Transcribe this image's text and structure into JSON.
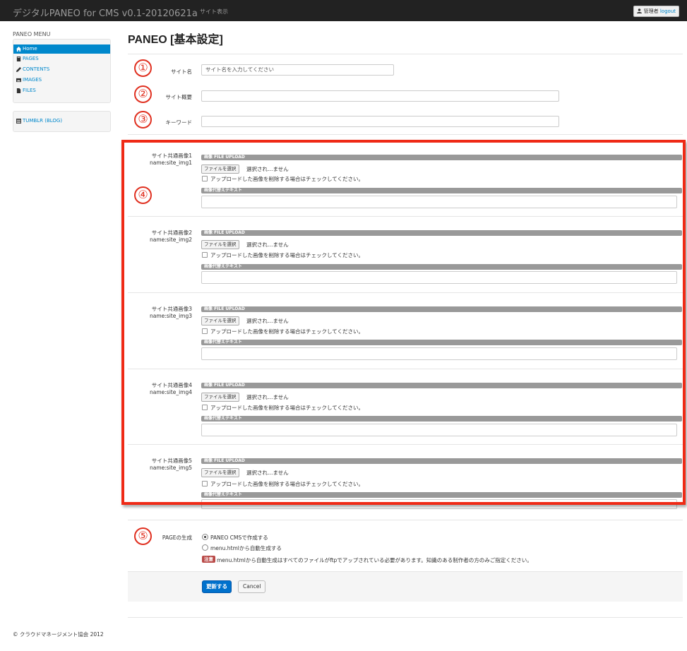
{
  "header": {
    "brand": "デジタルPANEO for CMS v0.1-20120621a",
    "nav_link": "サイト表示",
    "user_label": "管理者",
    "logout": "logout"
  },
  "sidebar": {
    "title": "PANEO MENU",
    "items": [
      {
        "label": "Home",
        "icon": "home-icon"
      },
      {
        "label": "PAGES",
        "icon": "book-icon"
      },
      {
        "label": "CONTENTS",
        "icon": "pencil-icon"
      },
      {
        "label": "IMAGES",
        "icon": "picture-icon"
      },
      {
        "label": "FILES",
        "icon": "file-icon"
      }
    ],
    "extra": {
      "label": "TUMBLR (BLOG)",
      "icon": "list-icon"
    }
  },
  "page": {
    "title": "PANEO [基本設定]"
  },
  "annotations": [
    "①",
    "②",
    "③",
    "④",
    "⑤"
  ],
  "fields": {
    "site_name": {
      "label": "サイト名",
      "value": "サイト名を入力してください"
    },
    "site_summary": {
      "label": "サイト概要",
      "value": ""
    },
    "keywords": {
      "label": "キーワード",
      "value": ""
    }
  },
  "images": [
    {
      "label": "サイト共通画像1",
      "name": "name:site_img1"
    },
    {
      "label": "サイト共通画像2",
      "name": "name:site_img2"
    },
    {
      "label": "サイト共通画像3",
      "name": "name:site_img3"
    },
    {
      "label": "サイト共通画像4",
      "name": "name:site_img4"
    },
    {
      "label": "サイト共通画像5",
      "name": "name:site_img5"
    }
  ],
  "image_ui": {
    "upload_bar": "画像 FILE UPLOAD",
    "file_button": "ファイルを選択",
    "file_status": "選択され…ません",
    "delete_check": "アップロードした画像を削除する場合はチェックしてください。",
    "alt_bar": "画像代替えテキスト"
  },
  "page_gen": {
    "label": "PAGEの生成",
    "options": [
      "PANEO CMSで作成する",
      "menu.htmlから自動生成する"
    ],
    "selected": 0,
    "note_badge": "注意",
    "note": "menu.htmlから自動生成はすべてのファイルがftpでアップされている必要があります。知識のある制作者の方のみご指定ください。"
  },
  "actions": {
    "submit": "更新する",
    "cancel": "Cancel"
  },
  "footer": "© クラウドマネージメント協会 2012",
  "colors": {
    "accent": "#0088cc",
    "annotation": "#ef2a16",
    "topbar": "#222222"
  }
}
